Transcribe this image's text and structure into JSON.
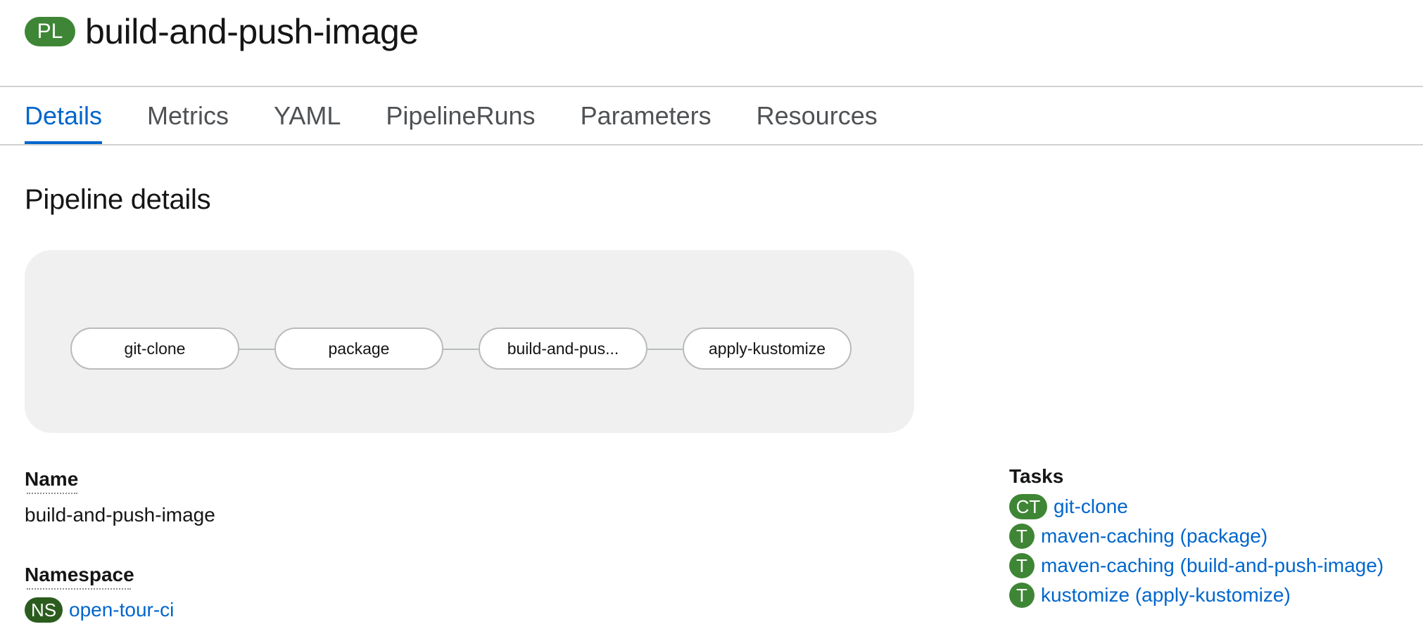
{
  "header": {
    "kind_badge": "PL",
    "title": "build-and-push-image"
  },
  "tabs": [
    {
      "label": "Details",
      "active": true
    },
    {
      "label": "Metrics",
      "active": false
    },
    {
      "label": "YAML",
      "active": false
    },
    {
      "label": "PipelineRuns",
      "active": false
    },
    {
      "label": "Parameters",
      "active": false
    },
    {
      "label": "Resources",
      "active": false
    }
  ],
  "section": {
    "title": "Pipeline details"
  },
  "pipeline": {
    "nodes": [
      "git-clone",
      "package",
      "build-and-pus...",
      "apply-kustomize"
    ]
  },
  "details": {
    "name_label": "Name",
    "name_value": "build-and-push-image",
    "namespace_label": "Namespace",
    "namespace_badge": "NS",
    "namespace_value": "open-tour-ci"
  },
  "tasks": {
    "label": "Tasks",
    "items": [
      {
        "badge": "CT",
        "name": "git-clone"
      },
      {
        "badge": "T",
        "name": "maven-caching (package)"
      },
      {
        "badge": "T",
        "name": "maven-caching (build-and-push-image)"
      },
      {
        "badge": "T",
        "name": "kustomize (apply-kustomize)"
      }
    ]
  },
  "colors": {
    "link": "#0066cc",
    "badge_green": "#3e8635",
    "badge_dark_green": "#2b5c1e",
    "diagram_bg": "#f0f0f0"
  }
}
